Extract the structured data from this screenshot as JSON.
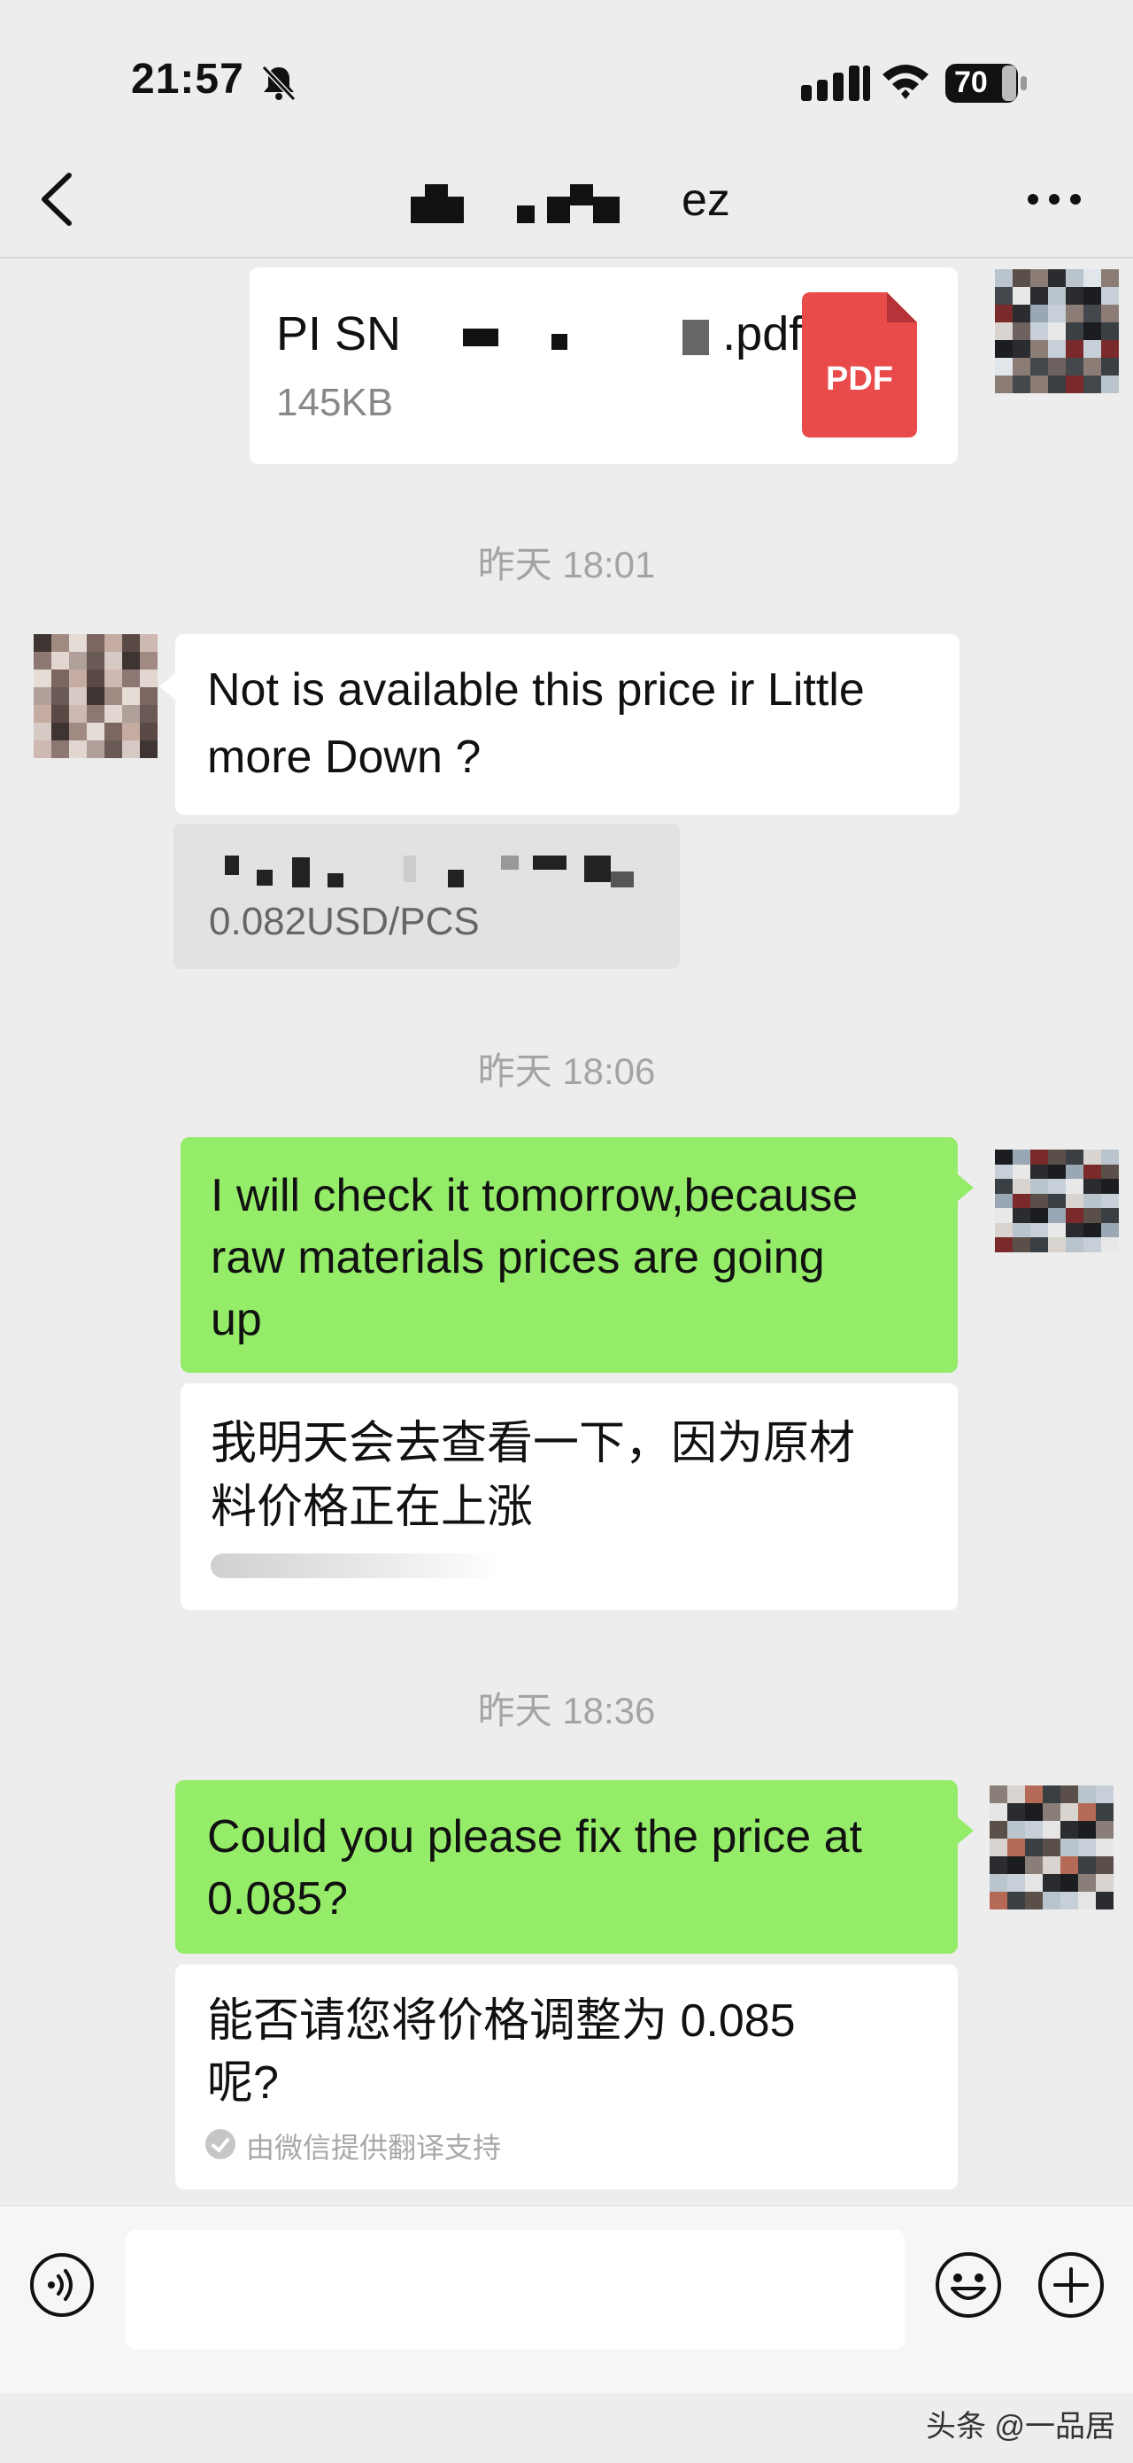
{
  "status_bar": {
    "time": "21:57",
    "battery": "70"
  },
  "nav": {
    "title_suffix": "ez"
  },
  "messages": {
    "file": {
      "name": "PI SN",
      "extension": ".pdf",
      "size": "145KB",
      "icon_label": "PDF"
    },
    "timestamp_1": "昨天 18:01",
    "incoming_1": {
      "line_1": "Not is available this price ir Little",
      "line_2": "more Down ?"
    },
    "quote_value": "0.082USD/PCS",
    "timestamp_2": "昨天 18:06",
    "outgoing_1": {
      "line_1": "I will check it tomorrow,because",
      "line_2": "raw materials prices are going",
      "line_3": "up"
    },
    "translation_1": {
      "line_1": "我明天会去查看一下，因为原材",
      "line_2": "料价格正在上涨"
    },
    "timestamp_3": "昨天 18:36",
    "outgoing_2": {
      "line_1": "Could you please fix the price at",
      "line_2": "0.085?"
    },
    "translation_2": {
      "line_1": "能否请您将价格调整为 0.085",
      "line_2": "呢?",
      "note": "由微信提供翻译支持"
    }
  },
  "input": {
    "placeholder": ""
  },
  "watermark": "头条 @一品居",
  "colors": {
    "background": "#ededed",
    "outgoing_bubble": "#95ec69",
    "incoming_bubble": "#ffffff",
    "pdf_red": "#e94b4b"
  }
}
